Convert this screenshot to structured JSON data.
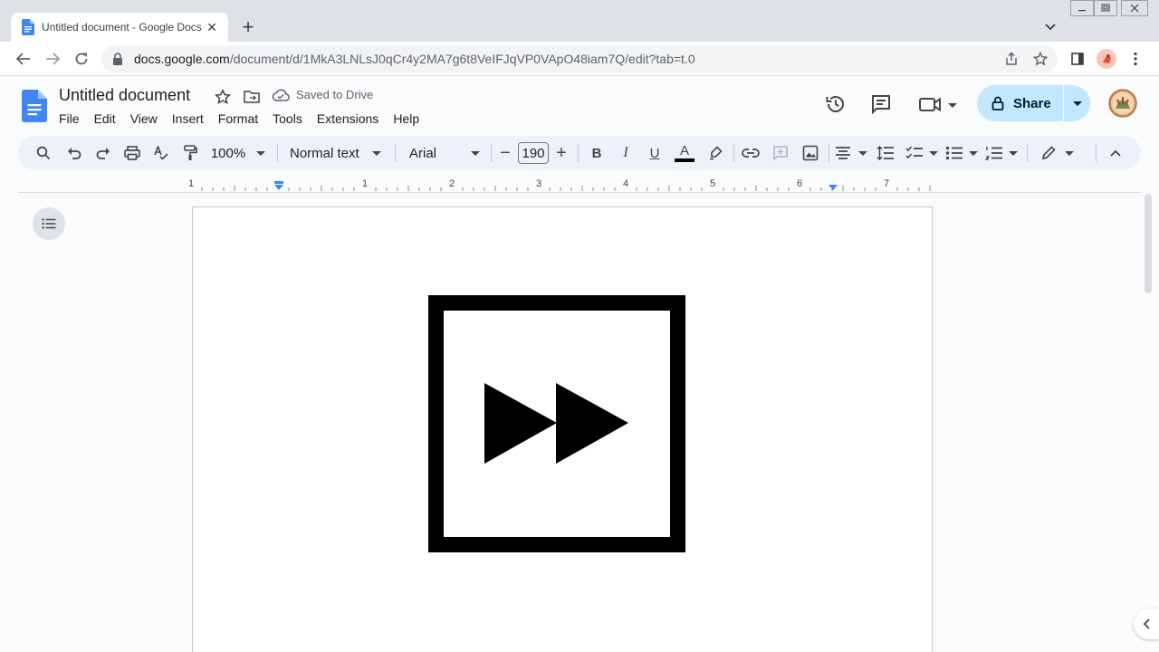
{
  "browser": {
    "tab_title": "Untitled document - Google Docs",
    "url_host": "docs.google.com",
    "url_path": "/document/d/1MkA3LNLsJ0qCr4y2MA7g6t8VeIFJqVP0VApO48iam7Q/edit?tab=t.0"
  },
  "doc": {
    "title": "Untitled document",
    "save_status": "Saved to Drive",
    "menu": [
      "File",
      "Edit",
      "View",
      "Insert",
      "Format",
      "Tools",
      "Extensions",
      "Help"
    ],
    "share_label": "Share"
  },
  "toolbar": {
    "zoom": "100%",
    "style": "Normal text",
    "font": "Arial",
    "font_size": "190",
    "text_color": "#000000"
  },
  "ruler": {
    "labels": [
      "1",
      "1",
      "2",
      "3",
      "4",
      "5",
      "6",
      "7"
    ]
  },
  "content": {
    "image_icon": "fast-forward-icon"
  },
  "colors": {
    "docs_blue": "#4285f4",
    "share_bg": "#c2e7ff",
    "toolbar_bg": "#edf2fa",
    "indent_marker": "#4285f4"
  }
}
